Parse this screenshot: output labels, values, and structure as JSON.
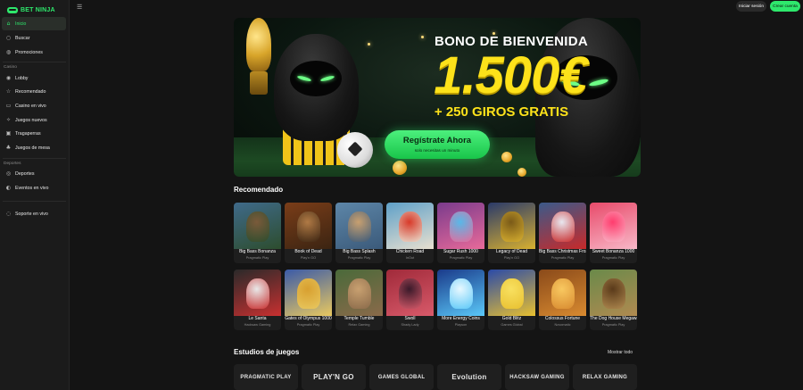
{
  "brand": {
    "name": "BET NINJA",
    "accent": "#2ee86c"
  },
  "sidebar": {
    "main_items": [
      {
        "label": "Inicio",
        "icon": "home-icon",
        "active": true
      },
      {
        "label": "Buscar",
        "icon": "search-icon"
      },
      {
        "label": "Promociones",
        "icon": "gift-icon"
      }
    ],
    "casino_label": "Casino",
    "casino_items": [
      {
        "label": "Lobby",
        "icon": "lobby-icon"
      },
      {
        "label": "Recomendado",
        "icon": "star-icon"
      },
      {
        "label": "Casino en vivo",
        "icon": "live-camera-icon"
      },
      {
        "label": "Juegos nuevos",
        "icon": "new-games-icon"
      },
      {
        "label": "Tragaperras",
        "icon": "slot-machine-icon"
      },
      {
        "label": "Juegos de mesa",
        "icon": "table-games-icon"
      }
    ],
    "sports_label": "Deportes",
    "sports_items": [
      {
        "label": "Deportes",
        "icon": "sports-icon"
      },
      {
        "label": "Eventos en vivo",
        "icon": "live-events-icon"
      }
    ],
    "support": {
      "label": "Soporte en vivo",
      "icon": "support-icon"
    }
  },
  "header": {
    "login": "Iniciar sesión",
    "register": "Crear cuenta",
    "menu_icon": "hamburger-menu-icon"
  },
  "banner": {
    "title": "BONO DE BIENVENIDA",
    "amount": "1.500€",
    "spins": "+ 250 GIROS GRATIS",
    "cta": "Regístrate Ahora",
    "cta_sub": "solo necesitas un minuto"
  },
  "recommended": {
    "title": "Recomendado",
    "games": [
      {
        "title": "Big Bass Bonanza",
        "provider": "Pragmatic Play"
      },
      {
        "title": "Book of Dead",
        "provider": "Play'n GO"
      },
      {
        "title": "Big Bass Splash",
        "provider": "Pragmatic Play"
      },
      {
        "title": "Chicken Road",
        "provider": "InOut"
      },
      {
        "title": "Sugar Rush 1000",
        "provider": "Pragmatic Play"
      },
      {
        "title": "Legacy of Dead",
        "provider": "Play'n GO"
      },
      {
        "title": "Big Bass Christmas Frozen Lake",
        "provider": "Pragmatic Play"
      },
      {
        "title": "Sweet Bonanza 1000",
        "provider": "Pragmatic Play"
      },
      {
        "title": "Le Santa",
        "provider": "Hacksaw Gaming"
      },
      {
        "title": "Gates of Olympus 1000",
        "provider": "Pragmatic Play"
      },
      {
        "title": "Temple Tumble",
        "provider": "Relax Gaming"
      },
      {
        "title": "Swoll",
        "provider": "Shady Lady"
      },
      {
        "title": "More Energy Coins",
        "provider": "Playson"
      },
      {
        "title": "Gold Blitz",
        "provider": "Games Global"
      },
      {
        "title": "Colossus Fortune",
        "provider": "Novomatic"
      },
      {
        "title": "The Dog House Megaways",
        "provider": "Pragmatic Play"
      }
    ]
  },
  "studios": {
    "title": "Estudios de juegos",
    "show_all": "Mostrar todo",
    "items": [
      "PRAGMATIC PLAY",
      "PLAY'N GO",
      "GAMES GLOBAL",
      "Evolution",
      "HACKSAW GAMING",
      "RELAX GAMING"
    ]
  }
}
